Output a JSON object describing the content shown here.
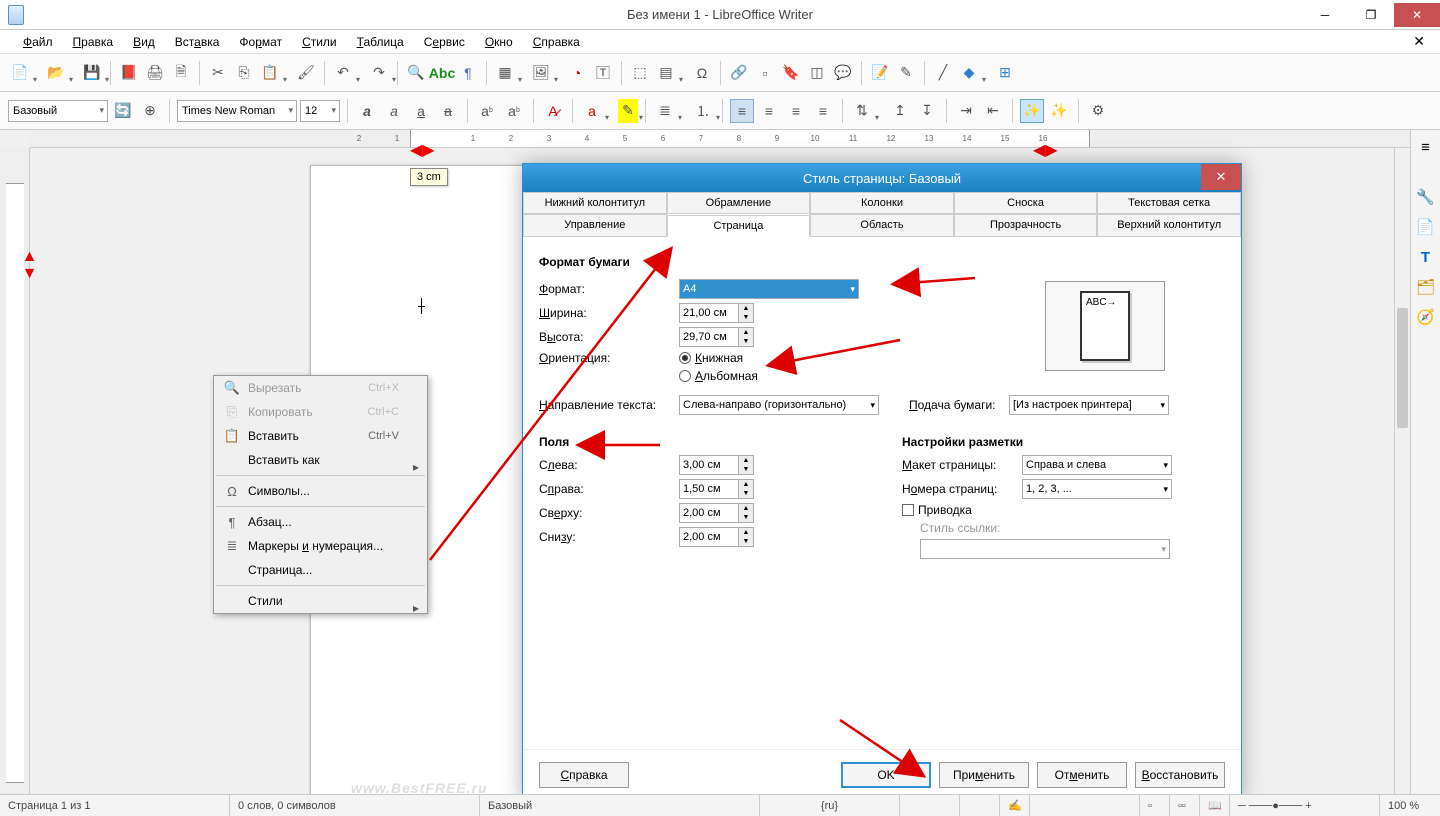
{
  "window": {
    "title": "Без имени 1 - LibreOffice Writer"
  },
  "menu": {
    "file": "Файл",
    "edit": "Правка",
    "view": "Вид",
    "insert": "Вставка",
    "format": "Формат",
    "styles": "Стили",
    "table": "Таблица",
    "tools": "Сервис",
    "window": "Окно",
    "help": "Справка"
  },
  "fmt": {
    "style": "Базовый",
    "font": "Times New Roman",
    "size": "12"
  },
  "tooltip": "3  cm",
  "watermark": "www.BestFREE.ru",
  "status": {
    "page": "Страница 1 из 1",
    "words": "0 слов, 0 символов",
    "pgstyle": "Базовый",
    "lang": "{ru}",
    "zoom": "100 %"
  },
  "context": {
    "cut": "Вырезать",
    "cut_sc": "Ctrl+X",
    "copy": "Копировать",
    "copy_sc": "Ctrl+C",
    "paste": "Вставить",
    "paste_sc": "Ctrl+V",
    "paste_as": "Вставить как",
    "symbols": "Символы...",
    "paragraph": "Абзац...",
    "bullets": "Маркеры и нумерация...",
    "page": "Страница...",
    "styles": "Стили"
  },
  "dialog": {
    "title": "Стиль страницы: Базовый",
    "tabs_row1": [
      "Нижний колонтитул",
      "Обрамление",
      "Колонки",
      "Сноска",
      "Текстовая сетка"
    ],
    "tabs_row2": [
      "Управление",
      "Страница",
      "Область",
      "Прозрачность",
      "Верхний колонтитул"
    ],
    "active_tab": "Страница",
    "paper_group": "Формат бумаги",
    "format_lbl": "Формат:",
    "format_val": "A4",
    "width_lbl": "Ширина:",
    "width_val": "21,00 см",
    "height_lbl": "Высота:",
    "height_val": "29,70 см",
    "orient_lbl": "Ориентация:",
    "orient_portrait": "Книжная",
    "orient_landscape": "Альбомная",
    "textdir_lbl": "Направление текста:",
    "textdir_val": "Слева-направо (горизонтально)",
    "feed_lbl": "Подача бумаги:",
    "feed_val": "[Из настроек принтера]",
    "margins_group": "Поля",
    "m_left": "Слева:",
    "m_left_v": "3,00 см",
    "m_right": "Справа:",
    "m_right_v": "1,50 см",
    "m_top": "Сверху:",
    "m_top_v": "2,00 см",
    "m_bottom": "Снизу:",
    "m_bottom_v": "2,00 см",
    "layout_group": "Настройки разметки",
    "layout_lbl": "Макет страницы:",
    "layout_val": "Справа и слева",
    "pgnum_lbl": "Номера страниц:",
    "pgnum_val": "1, 2, 3, ...",
    "register": "Приводка",
    "refstyle": "Стиль ссылки:",
    "preview": "ABC→",
    "btn_help": "Справка",
    "btn_ok": "OK",
    "btn_apply": "Применить",
    "btn_cancel": "Отменить",
    "btn_reset": "Восстановить"
  }
}
